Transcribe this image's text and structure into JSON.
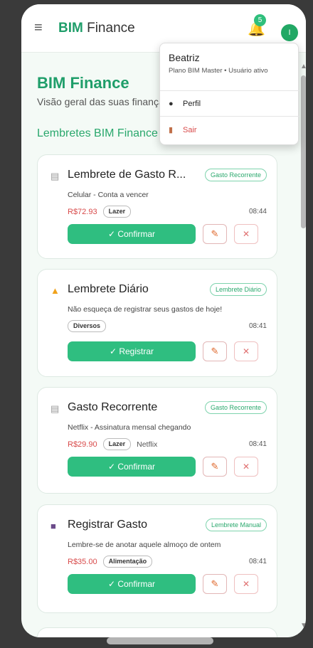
{
  "header": {
    "brand_strong": "BIM",
    "brand_rest": " Finance",
    "notification_count": "5",
    "avatar_letter": "I"
  },
  "page": {
    "title": "BIM Finance",
    "subtitle": "Visão geral das suas finanças",
    "section": "Lembretes BIM Finance"
  },
  "user_menu": {
    "name": "Beatriz",
    "plan": "Plano BIM Master • Usuário ativo",
    "profile": "Perfil",
    "logout": "Sair"
  },
  "cards": [
    {
      "icon": "receipt-icon",
      "title": "Lembrete de Gasto R...",
      "tag": "Gasto Recorrente",
      "desc": "Celular - Conta a vencer",
      "amount": "R$72.93",
      "chip": "Lazer",
      "extra": "",
      "time": "08:44",
      "action": "✓ Confirmar"
    },
    {
      "icon": "bell-icon",
      "title": "Lembrete Diário",
      "tag": "Lembrete Diário",
      "desc": "Não esqueça de registrar seus gastos de hoje!",
      "amount": "",
      "chip": "Diversos",
      "extra": "",
      "time": "08:41",
      "action": "✓ Registrar"
    },
    {
      "icon": "receipt-icon",
      "title": "Gasto Recorrente",
      "tag": "Gasto Recorrente",
      "desc": "Netflix - Assinatura mensal chegando",
      "amount": "R$29.90",
      "chip": "Lazer",
      "extra": "Netflix",
      "time": "08:41",
      "action": "✓ Confirmar"
    },
    {
      "icon": "book-icon",
      "title": "Registrar Gasto",
      "tag": "Lembrete Manual",
      "desc": "Lembre-se de anotar aquele almoço de ontem",
      "amount": "R$35.00",
      "chip": "Alimentação",
      "extra": "",
      "time": "08:41",
      "action": "✓ Confirmar"
    }
  ],
  "icons": {
    "edit": "✎",
    "delete": "✕",
    "menu": "≡"
  },
  "colors": {
    "brand": "#1f9e6a",
    "primary_button": "#2fbe80",
    "amount": "#d84a4a"
  }
}
